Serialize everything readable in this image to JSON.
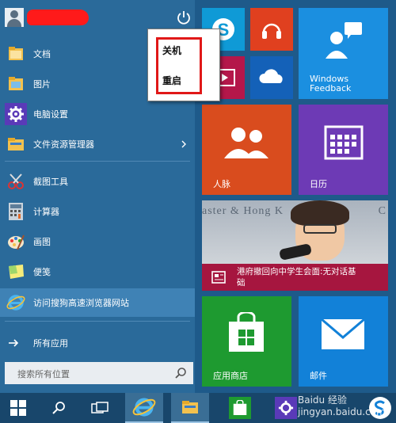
{
  "start_menu": {
    "items": [
      {
        "label": "文档",
        "icon": "folder-icon"
      },
      {
        "label": "图片",
        "icon": "folder-icon"
      },
      {
        "label": "电脑设置",
        "icon": "gear-icon"
      },
      {
        "label": "文件资源管理器",
        "icon": "file-explorer-icon"
      },
      {
        "label": "截图工具",
        "icon": "scissors-icon"
      },
      {
        "label": "计算器",
        "icon": "calculator-icon"
      },
      {
        "label": "画图",
        "icon": "paint-icon"
      },
      {
        "label": "便笺",
        "icon": "sticky-note-icon"
      },
      {
        "label": "访问搜狗高速浏览器网站",
        "icon": "ie-icon"
      }
    ],
    "all_apps": "所有应用",
    "search_placeholder": "搜索所有位置"
  },
  "power_menu": {
    "shutdown": "关机",
    "restart": "重启"
  },
  "tiles": {
    "windows_feedback": {
      "line1": "Windows",
      "line2": "Feedback"
    },
    "people": "人脉",
    "calendar": "日历",
    "news_headline": "港府撤回向中学生会面:无对话基础",
    "store": "应用商店",
    "mail": "邮件",
    "news_banner_text": "aster & Hong K",
    "news_banner_right": "C"
  },
  "colors": {
    "start_bg": "#2a6a9a",
    "skype": "#0f9ad6",
    "music": "#e0401f",
    "video": "#b4174a",
    "onedrive": "#1461b8",
    "feedback": "#1b8fe0",
    "people": "#d94c1e",
    "calendar": "#6d3ab5",
    "news": "#a6163f",
    "store": "#1e9a30",
    "mail": "#1281d8"
  },
  "watermark": "Baidu 经验 jingyan.baidu.com"
}
